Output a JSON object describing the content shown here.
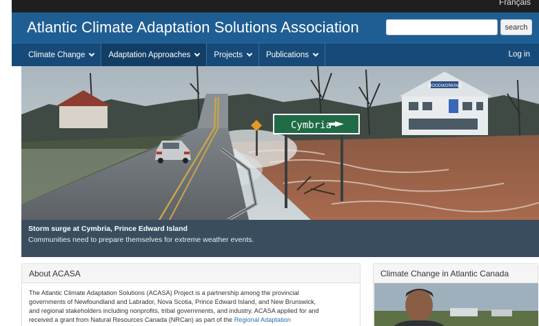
{
  "language_link": "Français",
  "header": {
    "site_title": "Atlantic Climate Adaptation Solutions Association",
    "search_placeholder": "",
    "search_button": "search"
  },
  "nav": {
    "items": [
      {
        "label": "Climate Change",
        "has_dropdown": true
      },
      {
        "label": "Adaptation Approaches",
        "has_dropdown": true
      },
      {
        "label": "Projects",
        "has_dropdown": true
      },
      {
        "label": "Publications",
        "has_dropdown": true
      }
    ],
    "active_index": 1,
    "login": "Log in"
  },
  "hero": {
    "sign_text": "Cymbria",
    "building_sign": "WOODWORKING",
    "caption_title": "Storm surge at Cymbria, Prince Edward Island",
    "caption_text": "Communities need to prepare themselves for extreme weather events."
  },
  "about": {
    "heading": "About ACASA",
    "lines": [
      "The Atlantic Climate Adaptation Solutions (ACASA) Project is a partnership among the provincial",
      "governments of Newfoundland and Labrador, Nova Scotia, Prince Edward Island, and New Brunswick,",
      "and regional stakeholders including nonprofits, tribal governments, and industry. ACASA applied for and"
    ],
    "last_line_text": "received a grant from Natural Resources Canada (NRCan) as part of the ",
    "last_line_link": "Regional Adaptation"
  },
  "sidebar_panel": {
    "heading": "Climate Change in Atlantic Canada"
  },
  "colors": {
    "brand_bar": "#1f5e93",
    "nav_bar": "#174a78",
    "caption_bg": "#3a4d5e",
    "link": "#2a6fb0",
    "sign_green": "#1e6b45"
  }
}
